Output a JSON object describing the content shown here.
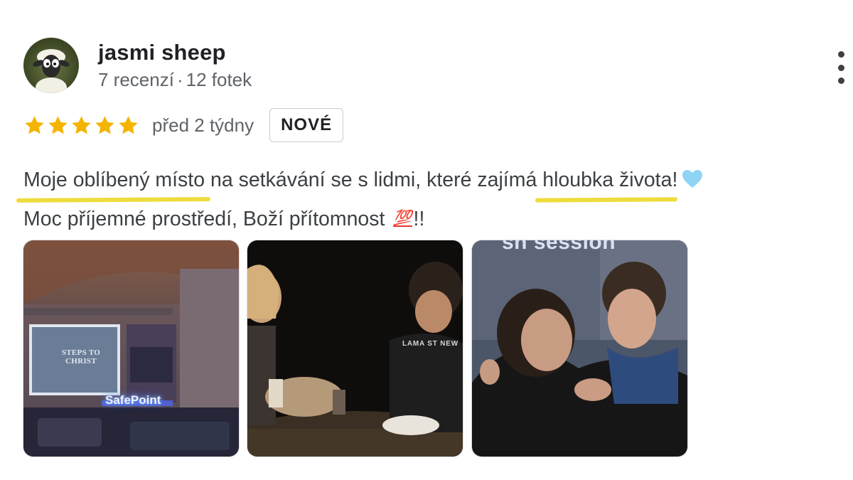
{
  "author": {
    "name": "jasmi sheep",
    "review_count": "7 recenzí",
    "separator": "·",
    "photo_count": "12 fotek",
    "avatar_icon": "shaun-the-sheep-avatar"
  },
  "review": {
    "rating": 5,
    "rating_max": 5,
    "star_color": "#f4b400",
    "time_ago": "před 2 týdny",
    "badge": "NOVÉ",
    "highlight_color": "#eedc3c",
    "text": {
      "line1_hl1": "Moje oblíbený místo",
      "line1_mid": " na setkávání se s lidmi, které zajímá ",
      "line1_hl2": "hloubka života",
      "line1_end": "!",
      "line2_start": "Moc příjemné prostředí, Boží přítomnost ",
      "emoji_100": "💯",
      "line2_end": "!!",
      "heart_icon": "light-blue-heart-emoji"
    }
  },
  "photos": [
    {
      "screen_title": "STEPS TO CHRIST",
      "sign": "SafePoint"
    },
    {
      "shirt_print": "LAMA ST NEW"
    },
    {
      "wall_text": "sh session"
    }
  ],
  "menu": {
    "icon": "more-vert-icon"
  }
}
